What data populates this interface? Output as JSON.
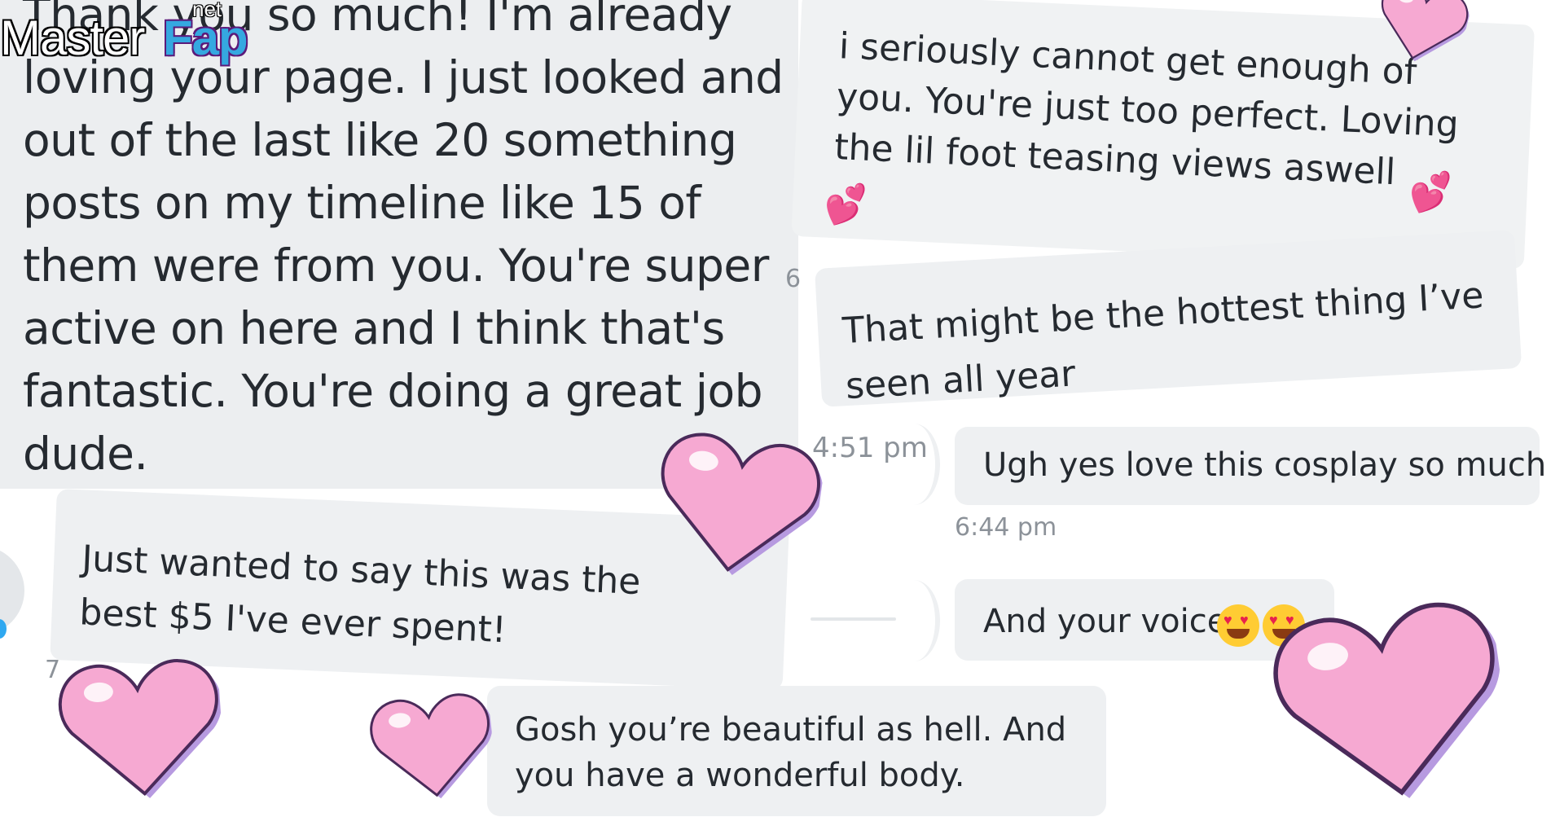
{
  "messages": [
    {
      "id": "thank-you",
      "text": "Thank you so much! I'm already\nloving your page. I just looked and\nout of the last like 20 something\nposts on my timeline like 15 of\nthem were from you. You're super\nactive on here and I think that's\nfantastic. You're doing a great job\ndude."
    },
    {
      "id": "cannot-get-enough",
      "text": "i seriously cannot get enough of\nyou. You're just too perfect. Loving\nthe lil foot teasing views aswell"
    },
    {
      "id": "hottest-thing",
      "text": "That might be the hottest thing I’ve\nseen all year"
    },
    {
      "id": "cosplay",
      "text": "Ugh yes love this cosplay so much"
    },
    {
      "id": "voice",
      "text": "And your voice"
    },
    {
      "id": "best-5",
      "text": "Just wanted to say this was the\nbest $5 I've ever spent!"
    },
    {
      "id": "beautiful",
      "text": "Gosh you’re beautiful as hell. And\nyou have a wonderful body."
    }
  ],
  "timestamps": {
    "t451": "4:51 pm",
    "t644": "6:44 pm",
    "t6": "6",
    "t7": "7"
  },
  "watermark": {
    "part1": "Master",
    "part2": "Fap",
    "suffix": "net"
  },
  "stickers": {
    "pixel_heart_color": "#f7a8d4",
    "pixel_heart_outline": "#b08ad8",
    "emoji_hearts": "💕",
    "heart_eyes_icon": "heart-eyes-emoji"
  },
  "colors": {
    "bubble": "#eef0f2",
    "text": "#252a30",
    "timestamp": "#8c9299"
  }
}
